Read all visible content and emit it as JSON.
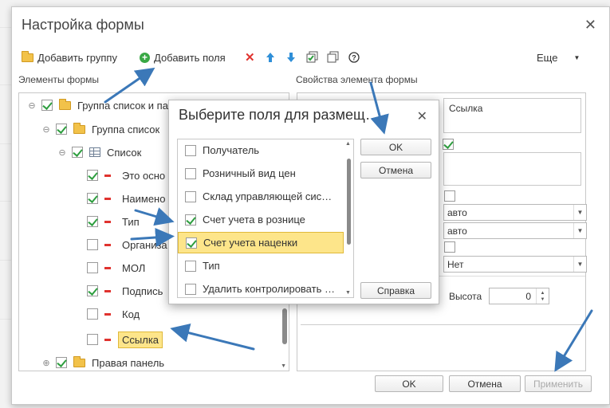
{
  "main": {
    "title": "Настройка формы",
    "toolbar": {
      "add_group": "Добавить группу",
      "add_fields": "Добавить поля",
      "more": "Еще"
    },
    "left_label": "Элементы формы",
    "right_label": "Свойства элемента формы",
    "tree": {
      "group_list_and_panel": "Группа список и па",
      "group_list": "Группа список",
      "list": "Список",
      "items": [
        "Это осно",
        "Наимено",
        "Тип",
        "Организа",
        "МОЛ",
        "Подпись",
        "Код",
        "Ссылка"
      ],
      "right_panel": "Правая панель"
    },
    "props": {
      "field_value": "Ссылка",
      "select1": "авто",
      "select2": "авто",
      "select3": "Нет",
      "height_label": "Высота",
      "height_value": "0"
    },
    "footer": {
      "ok": "OK",
      "cancel": "Отмена",
      "apply": "Применить"
    }
  },
  "popup": {
    "title": "Выберите поля для размещ…",
    "ok": "OK",
    "cancel": "Отмена",
    "help": "Справка",
    "items": [
      {
        "label": "Получатель",
        "checked": false
      },
      {
        "label": "Розничный вид цен",
        "checked": false
      },
      {
        "label": "Склад управляющей сис…",
        "checked": false
      },
      {
        "label": "Счет учета в рознице",
        "checked": true
      },
      {
        "label": "Счет учета наценки",
        "checked": true
      },
      {
        "label": "Тип",
        "checked": false
      },
      {
        "label": "Удалить контролировать …",
        "checked": false
      }
    ]
  },
  "colors": {
    "highlight": "#fde58a",
    "check": "#2e9e3f",
    "arrow": "#3b78b8",
    "minus": "#e0332f"
  }
}
